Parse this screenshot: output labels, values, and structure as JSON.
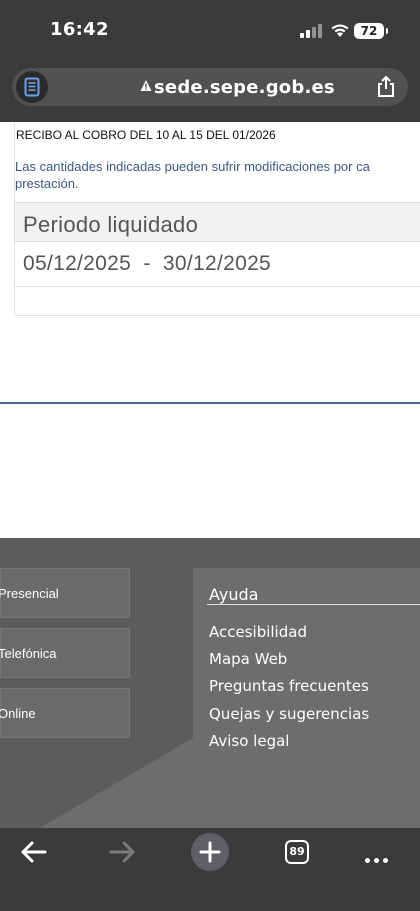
{
  "status_bar": {
    "time": "16:42",
    "battery": "72"
  },
  "browser": {
    "url": "sede.sepe.gob.es",
    "tab_count": "89"
  },
  "receipt": {
    "title": "RECIBO AL COBRO DEL 10 AL 15 DEL 01/2026",
    "notice_line1": "Las cantidades indicadas pueden sufrir modificaciones por ca",
    "notice_line2": "prestación.",
    "period_label": "Periodo liquidado",
    "period_dates": "05/12/2025  -  30/12/2025"
  },
  "footer": {
    "contact_items": [
      "Presencial",
      "Telefónica",
      "Online"
    ],
    "help_title": "Ayuda",
    "help_links": [
      "Accesibilidad",
      "Mapa Web",
      "Preguntas frecuentes",
      "Quejas y sugerencias",
      "Aviso legal"
    ]
  },
  "colors": {
    "chrome": "#3a3b3d",
    "notice": "#3b5a86",
    "footer": "#5c5c5c"
  }
}
